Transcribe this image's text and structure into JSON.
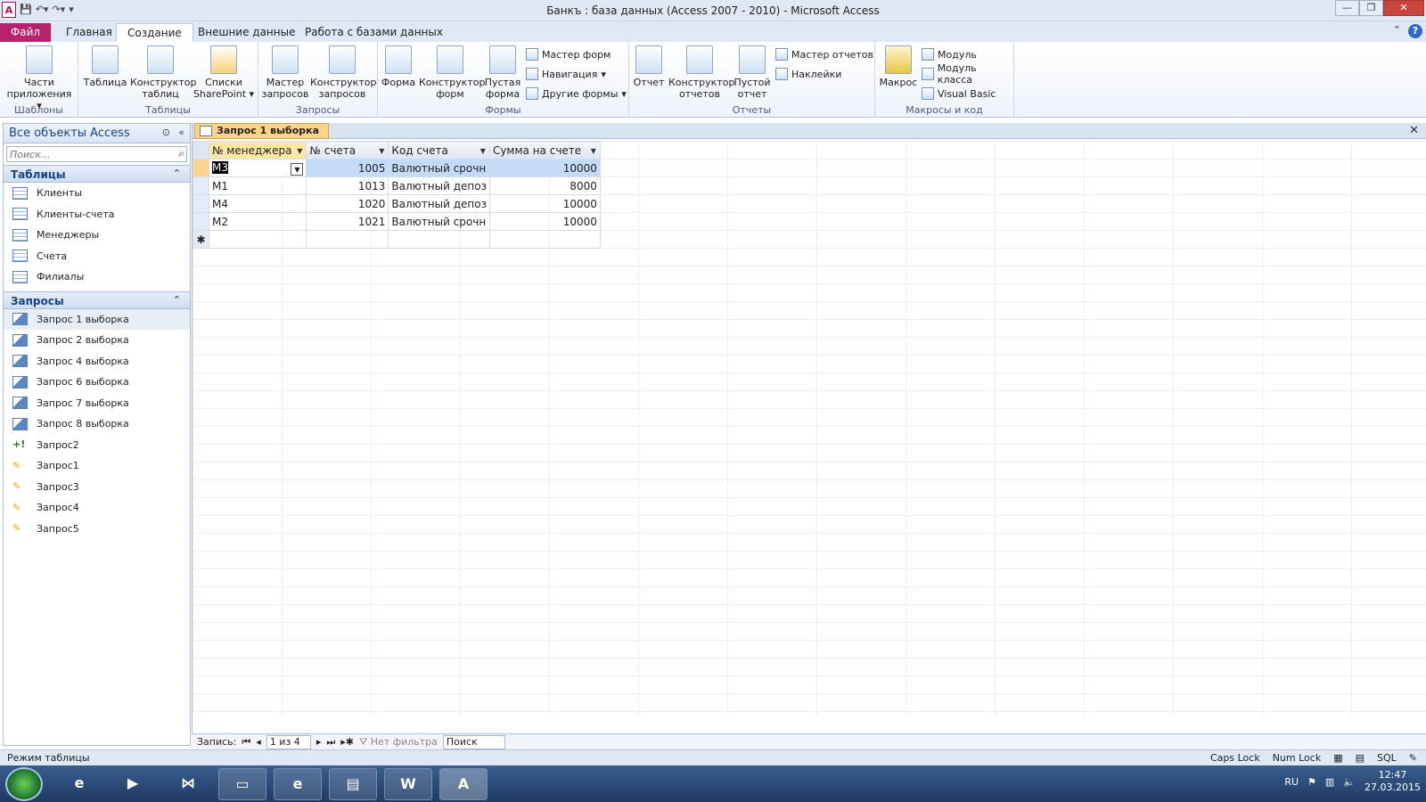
{
  "window": {
    "title": "Банкъ : база данных (Access 2007 - 2010)  -  Microsoft Access"
  },
  "tabs": [
    "Файл",
    "Главная",
    "Создание",
    "Внешние данные",
    "Работа с базами данных"
  ],
  "ribbon": {
    "templates": {
      "label": "Шаблоны",
      "parts": "Части приложения"
    },
    "tables": {
      "label": "Таблицы",
      "table": "Таблица",
      "designer": "Конструктор таблиц",
      "sharepoint": "Списки SharePoint"
    },
    "queries": {
      "label": "Запросы",
      "wizard": "Мастер запросов",
      "designer": "Конструктор запросов"
    },
    "forms": {
      "label": "Формы",
      "form": "Форма",
      "designer": "Конструктор форм",
      "blank": "Пустая форма",
      "wizard": "Мастер форм",
      "nav": "Навигация",
      "other": "Другие формы"
    },
    "reports": {
      "label": "Отчеты",
      "report": "Отчет",
      "designer": "Конструктор отчетов",
      "blank": "Пустой отчет",
      "wizard": "Мастер отчетов",
      "labels": "Наклейки"
    },
    "macros": {
      "label": "Макросы и код",
      "macro": "Макрос",
      "module": "Модуль",
      "class": "Модуль класса",
      "vb": "Visual Basic"
    }
  },
  "nav": {
    "title": "Все объекты Access",
    "search_placeholder": "Поиск...",
    "tables_header": "Таблицы",
    "tables": [
      "Клиенты",
      "Клиенты-счета",
      "Менеджеры",
      "Счета",
      "Филиалы"
    ],
    "queries_header": "Запросы",
    "queries": [
      "Запрос 1 выборка",
      "Запрос 2 выборка",
      "Запрос 4 выборка",
      "Запрос 6 выборка",
      "Запрос 7 выборка",
      "Запрос 8 выборка",
      "Запрос2",
      "Запрос1",
      "Запрос3",
      "Запрос4",
      "Запрос5"
    ]
  },
  "doc": {
    "tab": "Запрос 1 выборка",
    "columns": [
      "№ менеджера",
      "№ счета",
      "Код счета",
      "Сумма на счете"
    ],
    "rows": [
      [
        "М3",
        "1005",
        "Валютный срочн",
        "10000"
      ],
      [
        "М1",
        "1013",
        "Валютный депоз",
        "8000"
      ],
      [
        "М4",
        "1020",
        "Валютный депоз",
        "10000"
      ],
      [
        "М2",
        "1021",
        "Валютный срочн",
        "10000"
      ]
    ]
  },
  "recnav": {
    "label": "Запись:",
    "pos": "1 из 4",
    "filter": "Нет фильтра",
    "search": "Поиск"
  },
  "status": {
    "left": "Режим таблицы",
    "caps": "Caps Lock",
    "num": "Num Lock"
  },
  "tray": {
    "lang": "RU",
    "time": "12:47",
    "date": "27.03.2015"
  }
}
